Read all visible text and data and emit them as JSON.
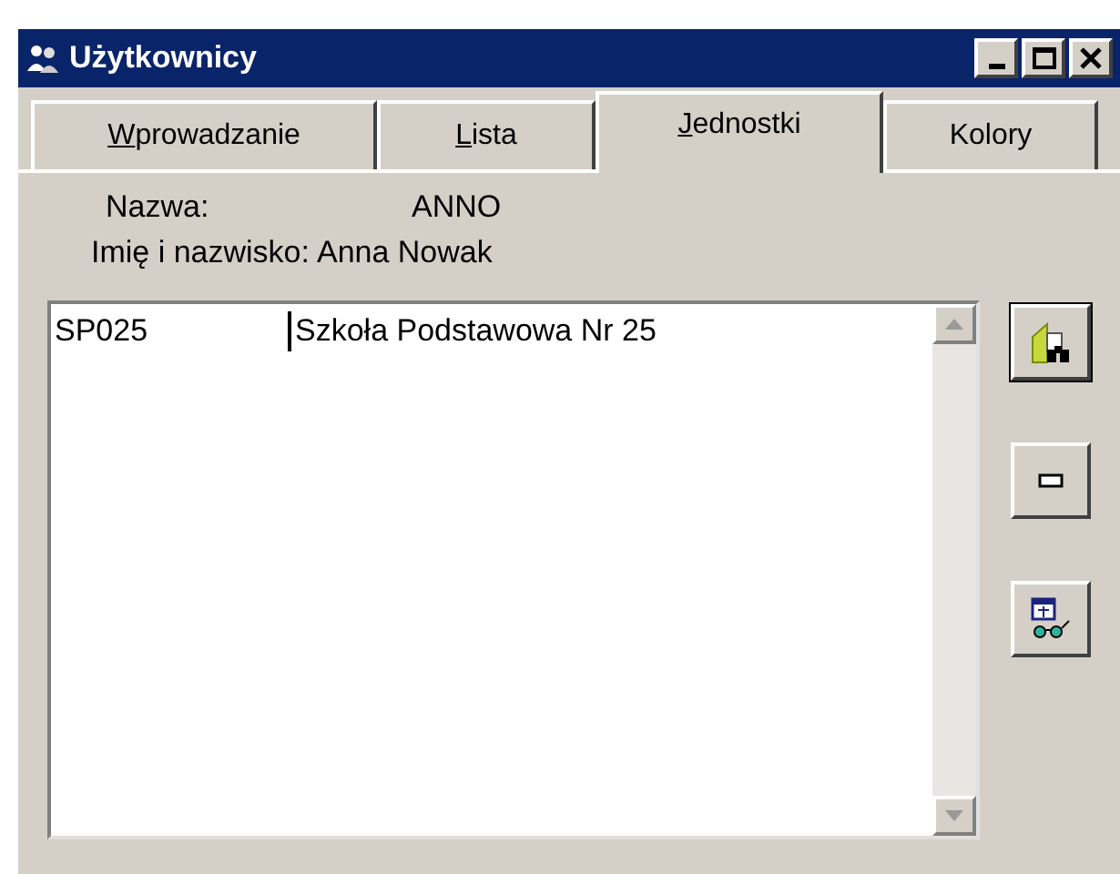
{
  "window": {
    "title": "Użytkownicy"
  },
  "tabs": [
    {
      "label": "Wprowadzanie",
      "selected": false,
      "mnemonic": true
    },
    {
      "label": "Lista",
      "selected": false,
      "mnemonic": true
    },
    {
      "label": "Jednostki",
      "selected": true,
      "mnemonic": true
    },
    {
      "label": "Kolory",
      "selected": false,
      "mnemonic": false
    }
  ],
  "fields": [
    {
      "label": "Nazwa:",
      "value": "ANNO"
    },
    {
      "label": "Imię i nazwisko:",
      "value": "Anna Nowak"
    }
  ],
  "list": {
    "rows": [
      {
        "code": "SP025",
        "name": "Szkoła Podstawowa Nr 25"
      }
    ]
  },
  "buttons": [
    {
      "kind": "find",
      "focused": true
    },
    {
      "kind": "remove",
      "focused": false
    },
    {
      "kind": "view",
      "focused": false
    }
  ]
}
